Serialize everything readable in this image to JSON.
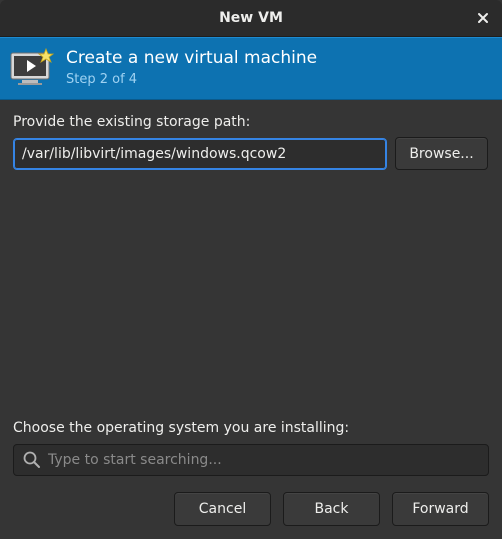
{
  "window": {
    "title": "New VM"
  },
  "banner": {
    "icon": "virtual-machine-icon",
    "heading": "Create a new virtual machine",
    "step": "Step 2 of 4"
  },
  "storage": {
    "label": "Provide the existing storage path:",
    "path_value": "/var/lib/libvirt/images/windows.qcow2",
    "browse_label": "Browse..."
  },
  "os": {
    "label": "Choose the operating system you are installing:",
    "search_placeholder": "Type to start searching...",
    "search_icon": "search-icon"
  },
  "actions": {
    "cancel_label": "Cancel",
    "back_label": "Back",
    "forward_label": "Forward"
  },
  "colors": {
    "banner_bg": "#0d72b1",
    "focus_ring": "#3584e4",
    "window_bg": "#353535"
  }
}
